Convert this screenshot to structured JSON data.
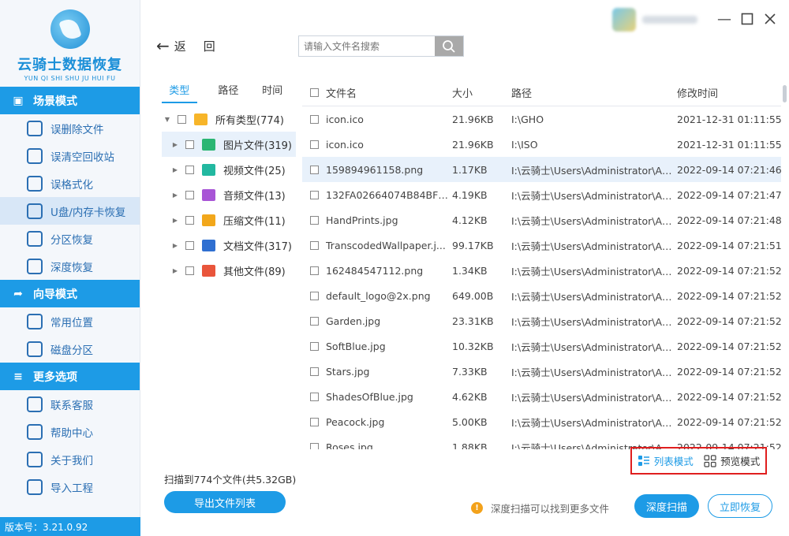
{
  "logo": {
    "name_cn": "云骑士数据恢复",
    "name_en": "YUN QI SHI SHU JU HUI FU"
  },
  "sidebar": {
    "sections": [
      {
        "title": "场景模式",
        "icon": "scene-icon",
        "items": [
          {
            "label": "误删除文件",
            "icon": "deleted-file-icon",
            "active": false
          },
          {
            "label": "误清空回收站",
            "icon": "recycle-bin-icon",
            "active": false
          },
          {
            "label": "误格式化",
            "icon": "format-icon",
            "active": false
          },
          {
            "label": "U盘/内存卡恢复",
            "icon": "usb-drive-icon",
            "active": true
          },
          {
            "label": "分区恢复",
            "icon": "partition-icon",
            "active": false
          },
          {
            "label": "深度恢复",
            "icon": "deep-recovery-icon",
            "active": false
          }
        ]
      },
      {
        "title": "向导模式",
        "icon": "guide-icon",
        "items": [
          {
            "label": "常用位置",
            "icon": "common-location-icon",
            "active": false
          },
          {
            "label": "磁盘分区",
            "icon": "disk-partition-icon",
            "active": false
          }
        ]
      },
      {
        "title": "更多选项",
        "icon": "menu-icon",
        "items": [
          {
            "label": "联系客服",
            "icon": "support-icon",
            "active": false
          },
          {
            "label": "帮助中心",
            "icon": "help-icon",
            "active": false
          },
          {
            "label": "关于我们",
            "icon": "about-icon",
            "active": false
          },
          {
            "label": "导入工程",
            "icon": "import-icon",
            "active": false
          }
        ]
      }
    ],
    "version": "版本号：3.21.0.92"
  },
  "topbar": {
    "back_label": "返",
    "back2_label": "回",
    "search_placeholder": "请输入文件名搜索"
  },
  "category": {
    "tabs": [
      "类型",
      "路径",
      "时间"
    ],
    "active_tab": 0,
    "rows": [
      {
        "label": "所有类型(774)",
        "color": "#f7b529",
        "level": 0,
        "expanded": true
      },
      {
        "label": "图片文件(319)",
        "color": "#2bb673",
        "level": 1,
        "selected": true
      },
      {
        "label": "视频文件(25)",
        "color": "#22b8a0",
        "level": 1
      },
      {
        "label": "音频文件(13)",
        "color": "#a855d6",
        "level": 1
      },
      {
        "label": "压缩文件(11)",
        "color": "#f2a71b",
        "level": 1
      },
      {
        "label": "文档文件(317)",
        "color": "#2f6fd1",
        "level": 1
      },
      {
        "label": "其他文件(89)",
        "color": "#e9553b",
        "level": 1
      }
    ]
  },
  "table": {
    "headers": {
      "name": "文件名",
      "size": "大小",
      "path": "路径",
      "time": "修改时间"
    },
    "rows": [
      {
        "name": "icon.ico",
        "size": "21.96KB",
        "path": "I:\\GHO",
        "time": "2021-12-31 01:11:55",
        "hl": false
      },
      {
        "name": "icon.ico",
        "size": "21.96KB",
        "path": "I:\\ISO",
        "time": "2021-12-31 01:11:55",
        "hl": false
      },
      {
        "name": "159894961158.png",
        "size": "1.17KB",
        "path": "I:\\云骑士\\Users\\Administrator\\Ap...",
        "time": "2022-09-14 07:21:46",
        "hl": true
      },
      {
        "name": "132FA02664074B84BF67...",
        "size": "4.19KB",
        "path": "I:\\云骑士\\Users\\Administrator\\Ap...",
        "time": "2022-09-14 07:21:47",
        "hl": false
      },
      {
        "name": "HandPrints.jpg",
        "size": "4.12KB",
        "path": "I:\\云骑士\\Users\\Administrator\\Ap...",
        "time": "2022-09-14 07:21:48",
        "hl": false
      },
      {
        "name": "TranscodedWallpaper.j...",
        "size": "99.17KB",
        "path": "I:\\云骑士\\Users\\Administrator\\Ap...",
        "time": "2022-09-14 07:21:51",
        "hl": false
      },
      {
        "name": "162484547112.png",
        "size": "1.34KB",
        "path": "I:\\云骑士\\Users\\Administrator\\Ap...",
        "time": "2022-09-14 07:21:52",
        "hl": false
      },
      {
        "name": "default_logo@2x.png",
        "size": "649.00B",
        "path": "I:\\云骑士\\Users\\Administrator\\Ap...",
        "time": "2022-09-14 07:21:52",
        "hl": false
      },
      {
        "name": "Garden.jpg",
        "size": "23.31KB",
        "path": "I:\\云骑士\\Users\\Administrator\\Ap...",
        "time": "2022-09-14 07:21:52",
        "hl": false
      },
      {
        "name": "SoftBlue.jpg",
        "size": "10.32KB",
        "path": "I:\\云骑士\\Users\\Administrator\\Ap...",
        "time": "2022-09-14 07:21:52",
        "hl": false
      },
      {
        "name": "Stars.jpg",
        "size": "7.33KB",
        "path": "I:\\云骑士\\Users\\Administrator\\Ap...",
        "time": "2022-09-14 07:21:52",
        "hl": false
      },
      {
        "name": "ShadesOfBlue.jpg",
        "size": "4.62KB",
        "path": "I:\\云骑士\\Users\\Administrator\\Ap...",
        "time": "2022-09-14 07:21:52",
        "hl": false
      },
      {
        "name": "Peacock.jpg",
        "size": "5.00KB",
        "path": "I:\\云骑士\\Users\\Administrator\\Ap...",
        "time": "2022-09-14 07:21:52",
        "hl": false
      },
      {
        "name": "Roses.jpg",
        "size": "1.88KB",
        "path": "I:\\云骑士\\Users\\Administrator\\Ap...",
        "time": "2022-09-14 07:21:52",
        "hl": false
      }
    ]
  },
  "viewmode": {
    "list_label": "列表模式",
    "preview_label": "预览模式",
    "active": "list"
  },
  "bottom": {
    "scan_info": "扫描到774个文件(共5.32GB)",
    "export_label": "导出文件列表",
    "hint": "深度扫描可以找到更多文件",
    "deep_scan_label": "深度扫描",
    "recover_label": "立即恢复"
  },
  "colors": {
    "accent": "#1d9be6",
    "highlight": "#e8f1fb",
    "warn": "#f3a21b",
    "box": "#e01e1e"
  }
}
